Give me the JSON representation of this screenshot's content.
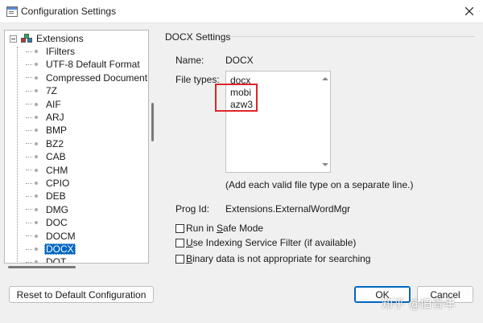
{
  "window": {
    "title": "Configuration Settings"
  },
  "tree": {
    "root_label": "Extensions",
    "items": [
      "IFilters",
      "UTF-8 Default Format",
      "Compressed Document R",
      "7Z",
      "AIF",
      "ARJ",
      "BMP",
      "BZ2",
      "CAB",
      "CHM",
      "CPIO",
      "DEB",
      "DMG",
      "DOC",
      "DOCM",
      "DOCX",
      "DOT"
    ],
    "selected": "DOCX"
  },
  "settings": {
    "group_title": "DOCX Settings",
    "name_label": "Name:",
    "name_value": "DOCX",
    "filetypes_label": "File types:",
    "filetypes": [
      "docx",
      "mobi",
      "azw3"
    ],
    "filetypes_hint": "(Add each valid file type on a separate line.)",
    "progid_label": "Prog Id:",
    "progid_value": "Extensions.ExternalWordMgr"
  },
  "options": {
    "safe_mode": {
      "pre": "Run in ",
      "key": "S",
      "post": "afe Mode",
      "checked": false
    },
    "indexing": {
      "pre": "",
      "key": "U",
      "post": "se Indexing Service Filter (if available)",
      "checked": false
    },
    "binary": {
      "pre": "",
      "key": "B",
      "post": "inary data is not appropriate for searching",
      "checked": false
    }
  },
  "buttons": {
    "reset": "Reset to Default Configuration",
    "ok": "OK",
    "cancel": "Cancel"
  },
  "watermark": "知乎 @旧青年",
  "colors": {
    "selection": "#0067c0",
    "highlight_box": "#e0242a"
  }
}
